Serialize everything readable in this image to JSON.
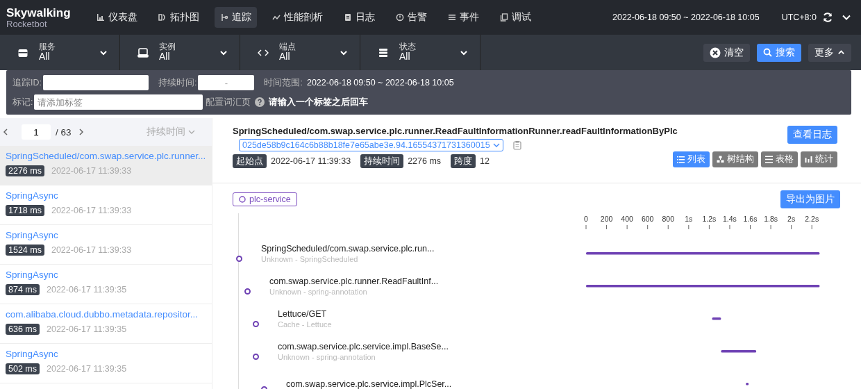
{
  "header": {
    "logo": {
      "title": "Skywalking",
      "subtitle": "Rocketbot"
    },
    "nav": [
      {
        "label": "仪表盘",
        "kind": "bars",
        "selected": false
      },
      {
        "label": "拓扑图",
        "kind": "topology",
        "selected": false
      },
      {
        "label": "追踪",
        "kind": "trace",
        "selected": true
      },
      {
        "label": "性能剖析",
        "kind": "line",
        "selected": false
      },
      {
        "label": "日志",
        "kind": "clipboard",
        "selected": false
      },
      {
        "label": "告警",
        "kind": "alert",
        "selected": false
      },
      {
        "label": "事件",
        "kind": "list",
        "selected": false
      },
      {
        "label": "调试",
        "kind": "copy",
        "selected": false
      }
    ],
    "time_range": "2022-06-18 09:50 ~ 2022-06-18 10:05",
    "timezone": "UTC+8:0"
  },
  "filters": [
    {
      "label": "服务",
      "value": "All",
      "kind": "box"
    },
    {
      "label": "实例",
      "value": "All",
      "kind": "server"
    },
    {
      "label": "端点",
      "value": "All",
      "kind": "code"
    },
    {
      "label": "状态",
      "value": "All",
      "kind": "stack"
    }
  ],
  "actions": {
    "clear": "清空",
    "search": "搜索",
    "more": "更多",
    "more_expanded": true
  },
  "more_panel": {
    "trace_id_label": "追踪ID:",
    "duration_label": "持续时间:",
    "duration_separator": "-",
    "time_range_label": "时间范围:",
    "time_range": "2022-06-18 09:50 ~ 2022-06-18 10:05",
    "tags_label": "标记:",
    "tags_placeholder": "请添加标签",
    "config_link": "配置词汇页",
    "tags_hint": "请输入一个标签之后回车"
  },
  "trace_list": {
    "page": "1",
    "total_pages": "/ 63",
    "sort": "持续时间",
    "items": [
      {
        "endpoint": "SpringScheduled/com.swap.service.plc.runner...",
        "duration": "2276 ms",
        "time": "2022-06-17 11:39:33",
        "selected": true
      },
      {
        "endpoint": "SpringAsync",
        "duration": "1718 ms",
        "time": "2022-06-17 11:39:33",
        "selected": false
      },
      {
        "endpoint": "SpringAsync",
        "duration": "1524 ms",
        "time": "2022-06-17 11:39:33",
        "selected": false
      },
      {
        "endpoint": "SpringAsync",
        "duration": "874 ms",
        "time": "2022-06-17 11:39:35",
        "selected": false
      },
      {
        "endpoint": "com.alibaba.cloud.dubbo.metadata.repositor...",
        "duration": "636 ms",
        "time": "2022-06-17 11:39:35",
        "selected": false
      },
      {
        "endpoint": "SpringAsync",
        "duration": "502 ms",
        "time": "2022-06-17 11:39:35",
        "selected": false
      }
    ]
  },
  "detail": {
    "title": "SpringScheduled/com.swap.service.plc.runner.ReadFaultInformationRunner.readFaultInformationByPlc",
    "view_log": "查看日志",
    "trace_id": "025de58b9c164c6b88b18fe7e65abe3e.94.16554371731360015",
    "tags": [
      {
        "label": "起始点",
        "value": "2022-06-17 11:39:33"
      },
      {
        "label": "持续时间",
        "value": "2276 ms"
      },
      {
        "label": "跨度",
        "value": "12"
      }
    ],
    "views": [
      {
        "label": "列表",
        "kind": "list",
        "selected": true
      },
      {
        "label": "树结构",
        "kind": "tree",
        "selected": false
      },
      {
        "label": "表格",
        "kind": "table",
        "selected": false
      },
      {
        "label": "统计",
        "kind": "stats",
        "selected": false
      }
    ],
    "service": "plc-service",
    "export": "导出为图片",
    "spans": [
      {
        "name": "SpringScheduled/com.swap.service.plc.run...",
        "subtitle": "Unknown - SpringScheduled",
        "children": [
          {
            "name": "com.swap.service.plc.runner.ReadFaultInf...",
            "subtitle": "Unknown - spring-annotation",
            "children": [
              {
                "name": "Lettuce/GET",
                "subtitle": "Cache - Lettuce"
              },
              {
                "name": "com.swap.service.plc.service.impl.BaseSe...",
                "subtitle": "Unknown - spring-annotation",
                "children": [
                  {
                    "name": "com.swap.service.plc.service.impl.PlcSer..."
                  }
                ]
              }
            ]
          }
        ]
      }
    ],
    "timeline_ticks": [
      "0",
      "200",
      "400",
      "600",
      "800",
      "1s",
      "1.2s",
      "1.4s",
      "1.6s",
      "1.8s",
      "2s",
      "2.2s"
    ]
  }
}
